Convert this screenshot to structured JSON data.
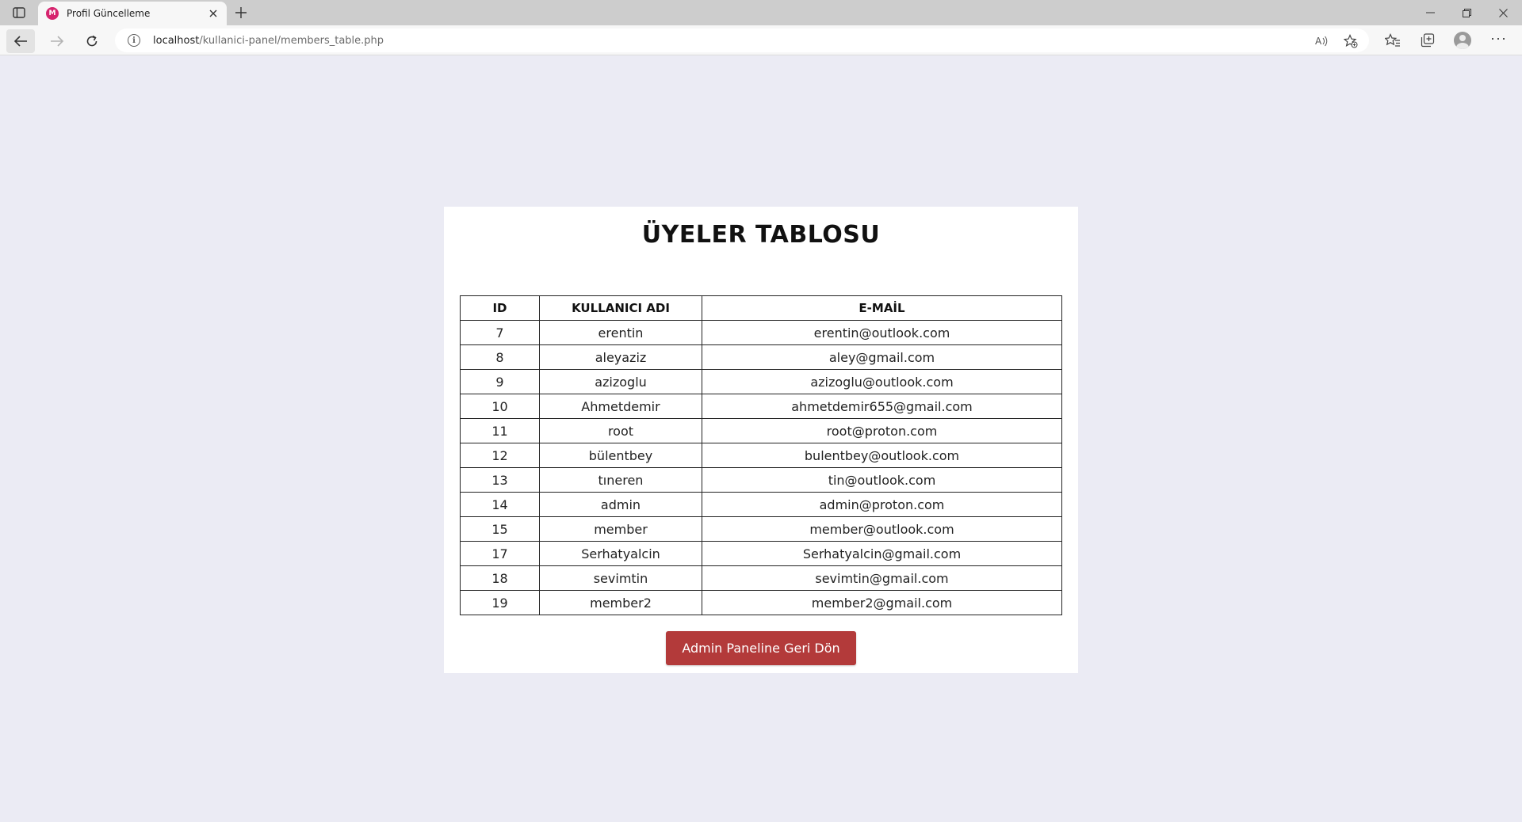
{
  "browser": {
    "tab_title": "Profil Güncelleme",
    "favicon_letter": "M",
    "url_host": "localhost",
    "url_path": "/kullanici-panel/members_table.php"
  },
  "page": {
    "title": "ÜYELER TABLOSU",
    "back_button_label": "Admin Paneline Geri Dön"
  },
  "table": {
    "headers": {
      "id": "ID",
      "username": "KULLANICI ADI",
      "email": "E-MAİL"
    },
    "rows": [
      {
        "id": "7",
        "username": "erentin",
        "email": "erentin@outlook.com"
      },
      {
        "id": "8",
        "username": "aleyaziz",
        "email": "aley@gmail.com"
      },
      {
        "id": "9",
        "username": "azizoglu",
        "email": "azizoglu@outlook.com"
      },
      {
        "id": "10",
        "username": "Ahmetdemir",
        "email": "ahmetdemir655@gmail.com"
      },
      {
        "id": "11",
        "username": "root",
        "email": "root@proton.com"
      },
      {
        "id": "12",
        "username": "bülentbey",
        "email": "bulentbey@outlook.com"
      },
      {
        "id": "13",
        "username": "tıneren",
        "email": "tin@outlook.com"
      },
      {
        "id": "14",
        "username": "admin",
        "email": "admin@proton.com"
      },
      {
        "id": "15",
        "username": "member",
        "email": "member@outlook.com"
      },
      {
        "id": "17",
        "username": "Serhatyalcin",
        "email": "Serhatyalcin@gmail.com"
      },
      {
        "id": "18",
        "username": "sevimtin",
        "email": "sevimtin@gmail.com"
      },
      {
        "id": "19",
        "username": "member2",
        "email": "member2@gmail.com"
      }
    ]
  },
  "colors": {
    "page_background": "#ebebf4",
    "card_background": "#ffffff",
    "button_background": "#b33a3a",
    "favicon": "#d6246e"
  },
  "icons": [
    "tab-actions-icon",
    "close-icon",
    "plus-icon",
    "minimize-icon",
    "restore-icon",
    "window-close-icon",
    "back-arrow-icon",
    "forward-arrow-icon",
    "reload-icon",
    "info-icon",
    "read-aloud-icon",
    "add-favorite-icon",
    "favorites-icon",
    "collections-icon",
    "profile-icon",
    "more-icon"
  ]
}
